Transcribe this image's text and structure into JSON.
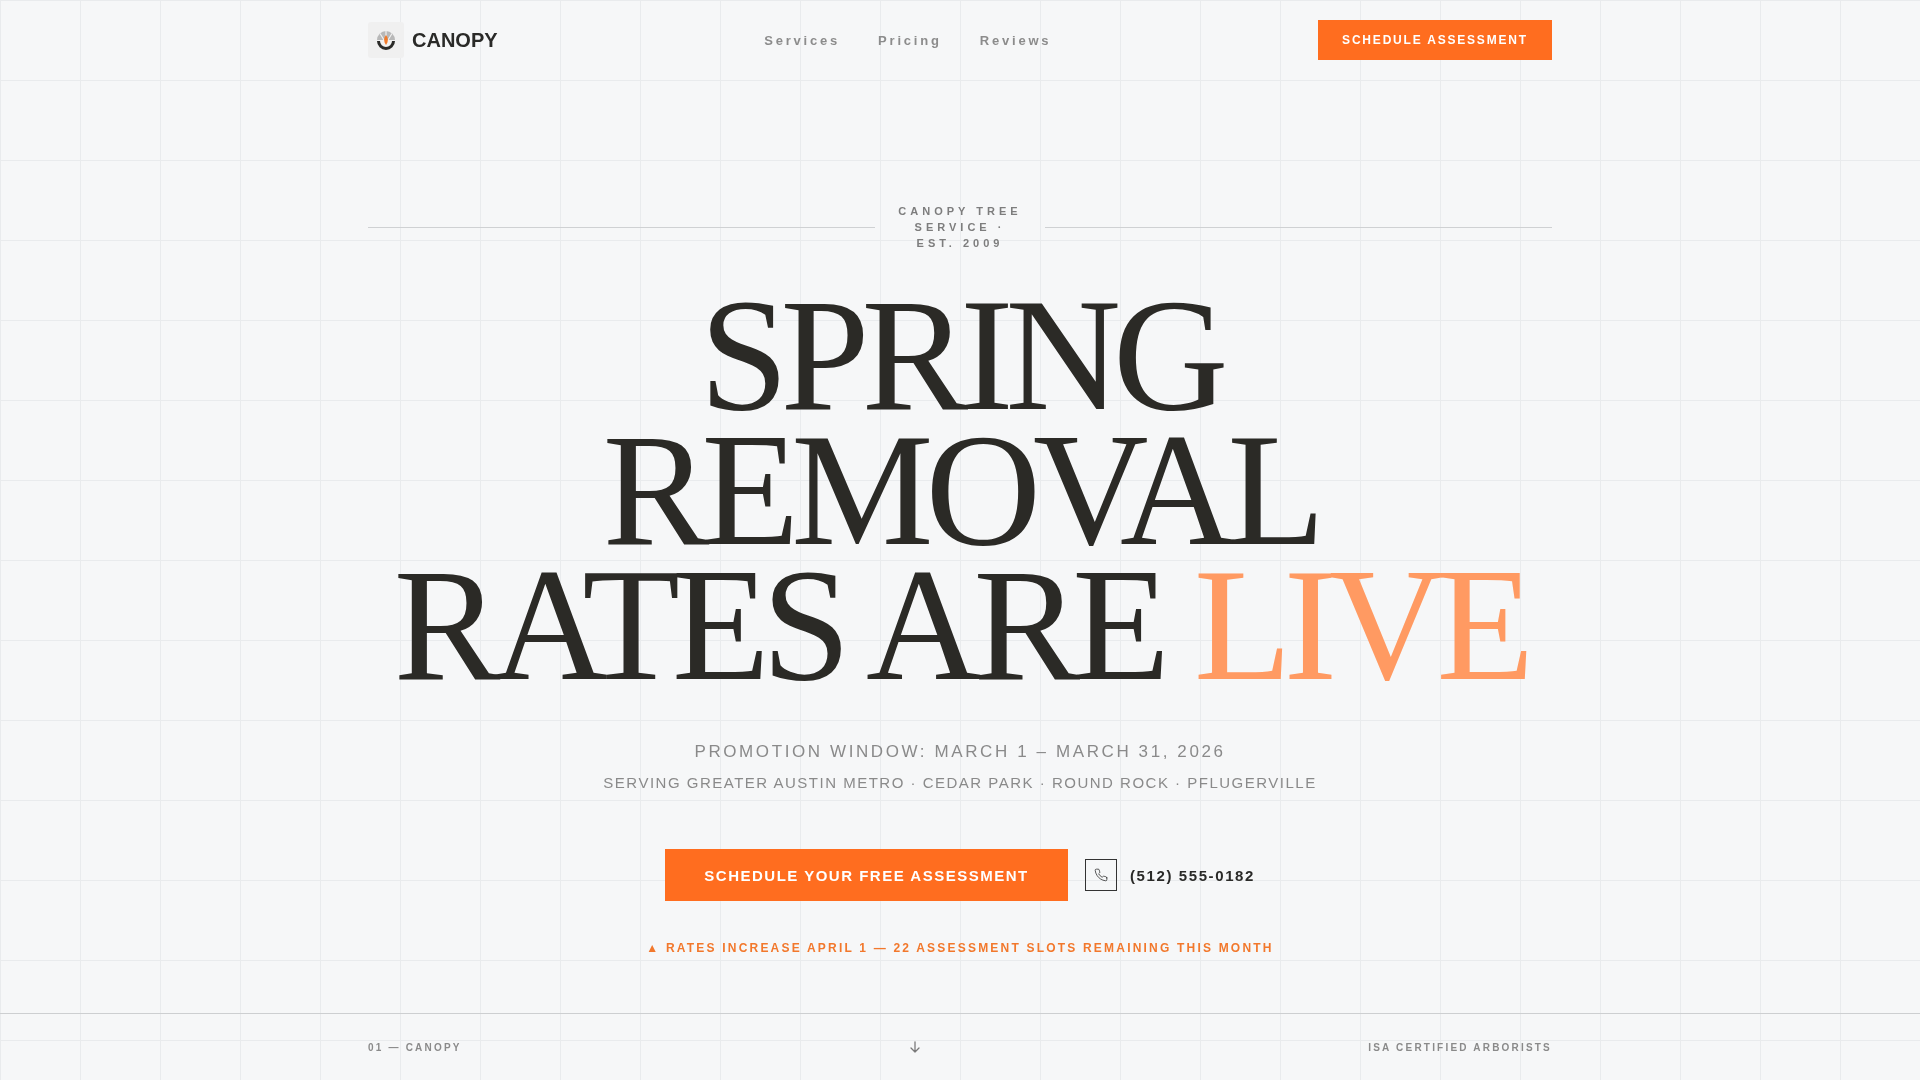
{
  "header": {
    "brand": "CANOPY",
    "nav": [
      {
        "label": "Services"
      },
      {
        "label": "Pricing"
      },
      {
        "label": "Reviews"
      }
    ],
    "cta": "SCHEDULE ASSESSMENT"
  },
  "hero": {
    "eyebrow": "CANOPY TREE SERVICE · EST. 2009",
    "headline": [
      {
        "text": "SPRING REMOVAL RATES ARE",
        "kind": "plain"
      },
      {
        "text": "LIVE",
        "kind": "accent"
      }
    ],
    "promotion": "PROMOTION WINDOW: MARCH 1 – MARCH 31, 2026",
    "service_area": "SERVING GREATER AUSTIN METRO · CEDAR PARK · ROUND ROCK · PFLUGERVILLE",
    "cta": "SCHEDULE YOUR FREE ASSESSMENT",
    "phone": "(512) 555-0182",
    "alert": "▲ RATES INCREASE APRIL 1 — 22 ASSESSMENT SLOTS REMAINING THIS MONTH"
  },
  "footer": {
    "section": "01 — CANOPY",
    "credential": "ISA CERTIFIED ARBORISTS"
  }
}
